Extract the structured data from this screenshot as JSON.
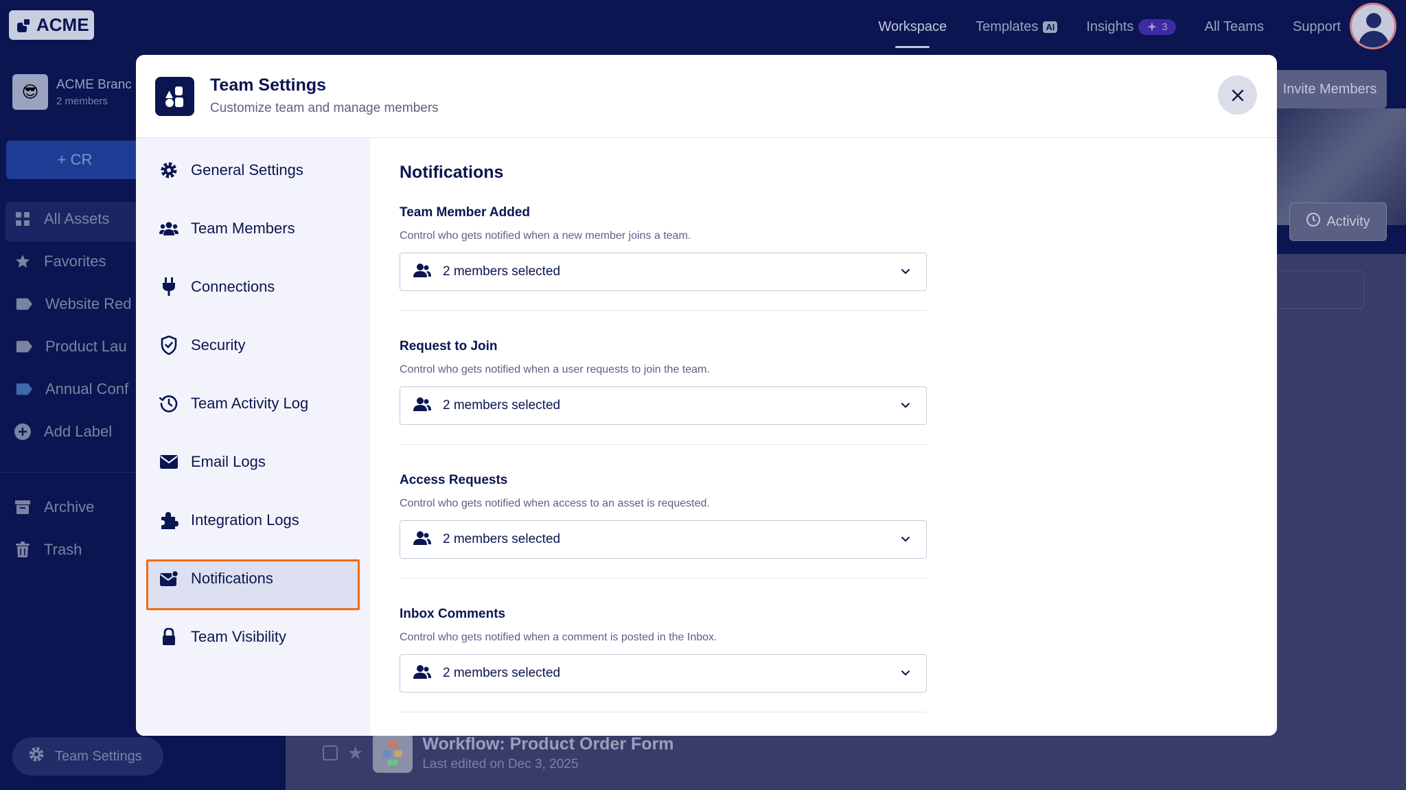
{
  "topnav": {
    "logo_text": "ACME",
    "links": [
      {
        "label": "Workspace"
      },
      {
        "label": "Templates",
        "badge": "AI"
      },
      {
        "label": "Insights",
        "badge": "3"
      },
      {
        "label": "All Teams"
      },
      {
        "label": "Support"
      }
    ]
  },
  "sidebar": {
    "team_name": "ACME Branc",
    "team_members": "2 members",
    "create_label": "+ CR",
    "items": [
      {
        "label": "All Assets"
      },
      {
        "label": "Favorites"
      },
      {
        "label": "Website Red"
      },
      {
        "label": "Product Lau"
      },
      {
        "label": "Annual Conf"
      },
      {
        "label": "Add Label"
      },
      {
        "label": "Archive"
      },
      {
        "label": "Trash"
      }
    ],
    "team_settings_label": "Team Settings"
  },
  "background": {
    "invite_label": "Invite Members",
    "activity_label": "Activity",
    "row_title": "Workflow: Product Order Form",
    "row_subtitle": "Last edited on Dec 3, 2025"
  },
  "modal": {
    "title": "Team Settings",
    "subtitle": "Customize team and manage members",
    "nav": [
      {
        "label": "General Settings"
      },
      {
        "label": "Team Members"
      },
      {
        "label": "Connections"
      },
      {
        "label": "Security"
      },
      {
        "label": "Team Activity Log"
      },
      {
        "label": "Email Logs"
      },
      {
        "label": "Integration Logs"
      },
      {
        "label": "Notifications"
      },
      {
        "label": "Team Visibility"
      }
    ],
    "section_title": "Notifications",
    "groups": [
      {
        "title": "Team Member Added",
        "description": "Control who gets notified when a new member joins a team.",
        "value": "2 members selected"
      },
      {
        "title": "Request to Join",
        "description": "Control who gets notified when a user requests to join the team.",
        "value": "2 members selected"
      },
      {
        "title": "Access Requests",
        "description": "Control who gets notified when access to an asset is requested.",
        "value": "2 members selected"
      },
      {
        "title": "Inbox Comments",
        "description": "Control who gets notified when a comment is posted in the Inbox.",
        "value": "2 members selected"
      }
    ]
  },
  "colors": {
    "navy": "#0a1551",
    "highlight": "#f26b15",
    "modal_nav_bg": "#f3f4fb"
  }
}
